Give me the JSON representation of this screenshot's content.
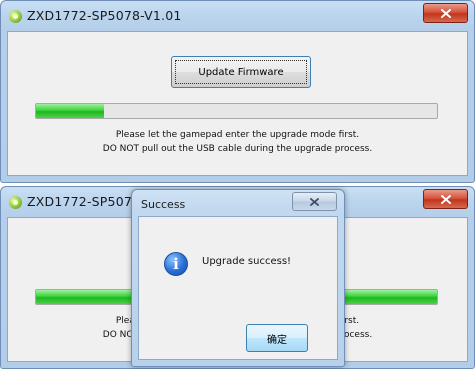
{
  "main_window": {
    "title": "ZXD1772-SP5078-V1.01",
    "close_symbol": "×",
    "update_button_label": "Update Firmware",
    "message_line1": "Please let the gamepad enter the upgrade mode first.",
    "message_line2": "DO NOT pull out the USB cable during the upgrade process."
  },
  "top_progress": {
    "percent": 17
  },
  "bottom_progress": {
    "percent": 100
  },
  "dialog": {
    "title": "Success",
    "message": "Upgrade success!",
    "ok_label": "确定",
    "close_symbol": "×"
  },
  "colors": {
    "progress_green": "#22b522",
    "close_red": "#c2351c",
    "info_blue": "#2a6fd6"
  }
}
